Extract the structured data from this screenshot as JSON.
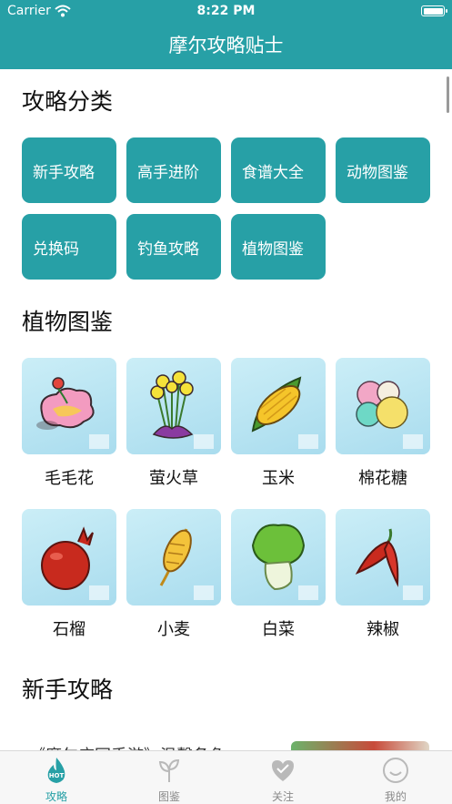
{
  "status_bar": {
    "carrier": "Carrier",
    "time": "8:22 PM"
  },
  "nav": {
    "title": "摩尔攻略贴士"
  },
  "categories": {
    "title": "攻略分类",
    "items": [
      "新手攻略",
      "高手进阶",
      "食谱大全",
      "动物图鉴",
      "兑换码",
      "钓鱼攻略",
      "植物图鉴"
    ]
  },
  "plants": {
    "title": "植物图鉴",
    "items": [
      {
        "name": "毛毛花",
        "icon": "pink-flower-icon"
      },
      {
        "name": "萤火草",
        "icon": "firefly-grass-icon"
      },
      {
        "name": "玉米",
        "icon": "corn-icon"
      },
      {
        "name": "棉花糖",
        "icon": "cotton-candy-icon"
      },
      {
        "name": "石榴",
        "icon": "pomegranate-icon"
      },
      {
        "name": "小麦",
        "icon": "wheat-icon"
      },
      {
        "name": "白菜",
        "icon": "bok-choy-icon"
      },
      {
        "name": "辣椒",
        "icon": "chili-pepper-icon"
      }
    ]
  },
  "guides": {
    "title": "新手攻略",
    "first_item_title": "《摩尔庄园手游》温馨备负"
  },
  "tabs": [
    {
      "label": "攻略",
      "icon": "hot-flame-icon",
      "active": true
    },
    {
      "label": "图鉴",
      "icon": "sprout-icon",
      "active": false
    },
    {
      "label": "关注",
      "icon": "heart-icon",
      "active": false
    },
    {
      "label": "我的",
      "icon": "smiley-face-icon",
      "active": false
    }
  ],
  "colors": {
    "accent": "#27a0a6",
    "tile_bg": "#bde6f3",
    "tab_inactive": "#8a8a8a"
  }
}
